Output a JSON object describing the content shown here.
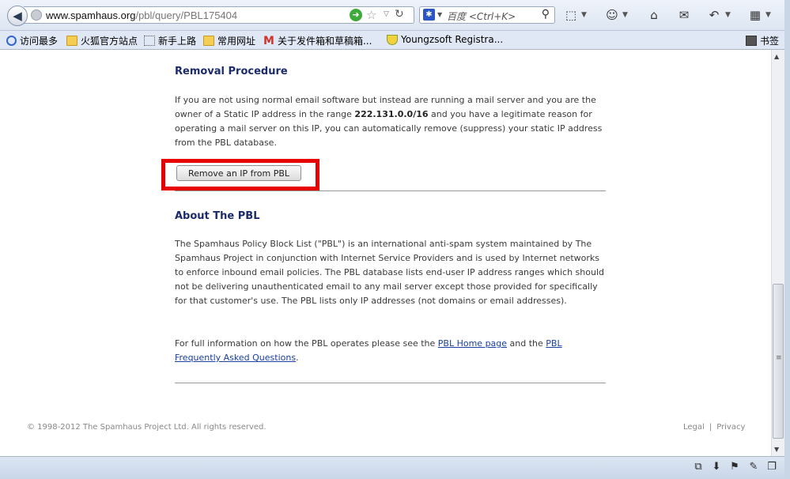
{
  "browser": {
    "url": {
      "host": "www.spamhaus.org",
      "path": "/pbl/query/PBL175404"
    },
    "search": {
      "engine": "baidu",
      "placeholder": "百度 <Ctrl+K>"
    },
    "bookmarks": [
      {
        "label": "访问最多",
        "icon": "search-icon"
      },
      {
        "label": "火狐官方站点",
        "icon": "folder-icon"
      },
      {
        "label": "新手上路",
        "icon": "page-icon"
      },
      {
        "label": "常用网址",
        "icon": "folder-icon"
      },
      {
        "label": "关于发件箱和草稿箱...",
        "icon": "gmail-icon"
      },
      {
        "label": "Youngzsoft Registra...",
        "icon": "shield-icon"
      }
    ],
    "bookmarks_menu_label": "书签"
  },
  "page": {
    "removal": {
      "heading": "Removal Procedure",
      "text_1": "If you are not using normal email software but instead are running a mail server and you are the owner of a Static IP address in the range ",
      "ip_range": "222.131.0.0/16",
      "text_2": " and you have a legitimate reason for operating a mail server on this IP, you can automatically remove (suppress) your static IP address from the PBL database.",
      "button_label": "Remove an IP from PBL"
    },
    "about": {
      "heading": "About The PBL",
      "text": "The Spamhaus Policy Block List (\"PBL\") is an international anti-spam system maintained by The Spamhaus Project in conjunction with Internet Service Providers and is used by Internet networks to enforce inbound email policies. The PBL database lists end-user IP address ranges which should not be delivering unauthenticated email to any mail server except those provided for specifically for that customer's use. The PBL lists only IP addresses (not domains or email addresses).",
      "info_prefix": "For full information on how the PBL operates please see the ",
      "link_home": "PBL Home page",
      "info_middle": " and the ",
      "link_faq": "PBL Frequently Asked Questions",
      "info_suffix": "."
    },
    "footer": {
      "copyright": "© 1998-2012 The Spamhaus Project Ltd. All rights reserved.",
      "legal": "Legal",
      "separator": "|",
      "privacy": "Privacy"
    }
  },
  "colors": {
    "heading": "#1c2b6b",
    "link": "#1a3fa0",
    "highlight": "#e60000"
  }
}
